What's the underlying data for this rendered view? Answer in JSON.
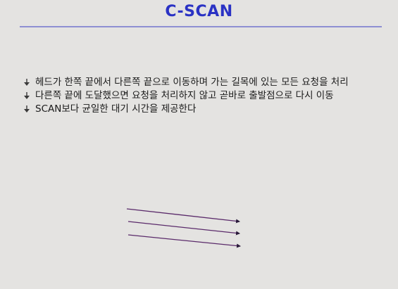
{
  "slide": {
    "title": "C-SCAN",
    "title_color": "#2a32c4",
    "rule_color": "#8e8fd2",
    "bullets": [
      {
        "icon": "arrow-bullet-icon",
        "text": "헤드가 한쪽 끝에서 다른쪽 끝으로 이동하며 가는 길목에 있는 모든 요청을 처리"
      },
      {
        "icon": "arrow-bullet-icon",
        "text": "다른쪽 끝에 도달했으면 요청을 처리하지 않고 곧바로 출발점으로 다시 이동"
      },
      {
        "icon": "arrow-bullet-icon",
        "text": "SCAN보다 균일한 대기 시간을 제공한다"
      }
    ],
    "diagram": {
      "arrow_color": "#5a2a6a",
      "arrow_count": 3
    }
  }
}
